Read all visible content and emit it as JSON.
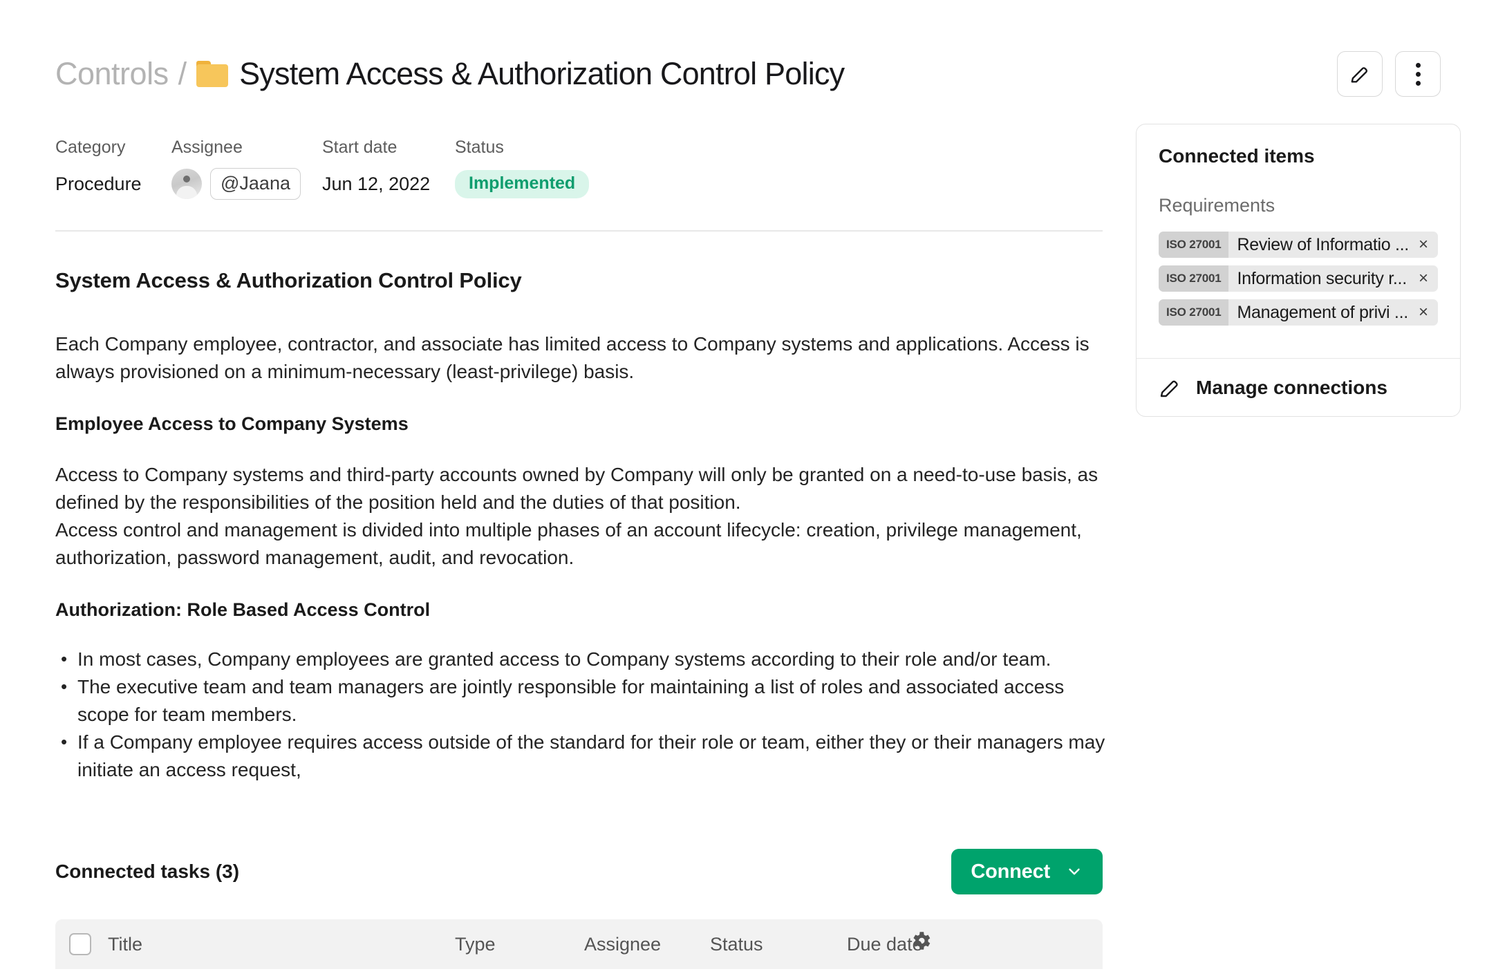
{
  "header": {
    "breadcrumb_parent": "Controls",
    "breadcrumb_separator": "/",
    "title": "System Access & Authorization Control Policy",
    "folder_icon": "folder-icon",
    "edit_icon": "pencil-icon",
    "more_icon": "kebab-menu-icon"
  },
  "meta": {
    "category_label": "Category",
    "category_value": "Procedure",
    "assignee_label": "Assignee",
    "assignee_value": "@Jaana",
    "start_date_label": "Start date",
    "start_date_value": "Jun 12, 2022",
    "status_label": "Status",
    "status_value": "Implemented",
    "status_color": "#0f9d6e",
    "status_bg": "#d9f5ea"
  },
  "document": {
    "heading": "System Access & Authorization Control Policy",
    "intro": "Each Company employee, contractor, and associate has limited access to Company systems and applications. Access is always provisioned on a minimum-necessary (least-privilege) basis.",
    "section1_heading": "Employee Access to Company Systems",
    "section1_p1": "Access to Company systems and third-party accounts owned by Company will only be granted on a need-to-use basis, as defined by the responsibilities of the position held and the duties of that position.",
    "section1_p2": "Access control and management is divided into multiple phases of an account lifecycle: creation, privilege management, authorization, password management, audit, and revocation.",
    "section2_heading": "Authorization: Role Based Access Control",
    "bullets": [
      "In most cases, Company employees are granted access to Company systems according to their role and/or team.",
      "The executive team and team managers are jointly responsible for maintaining a list of roles and associated access scope for team members.",
      "If a Company employee requires access outside of the standard for their role or team, either they or their managers may initiate an access request,"
    ]
  },
  "tasks": {
    "title": "Connected tasks (3)",
    "connect_label": "Connect",
    "connect_color": "#00a36c",
    "chevron_icon": "chevron-down-icon",
    "settings_icon": "gear-icon",
    "columns": [
      "Title",
      "Type",
      "Assignee",
      "Status",
      "Due date"
    ]
  },
  "connected_items": {
    "title": "Connected items",
    "subtitle": "Requirements",
    "requirements": [
      {
        "standard": "ISO 27001",
        "name": "Review of Informatio ...",
        "remove": "×"
      },
      {
        "standard": "ISO 27001",
        "name": "Information security r...",
        "remove": "×"
      },
      {
        "standard": "ISO 27001",
        "name": "Management of privi ...",
        "remove": "×"
      }
    ],
    "manage_label": "Manage connections",
    "manage_icon": "pencil-icon"
  }
}
